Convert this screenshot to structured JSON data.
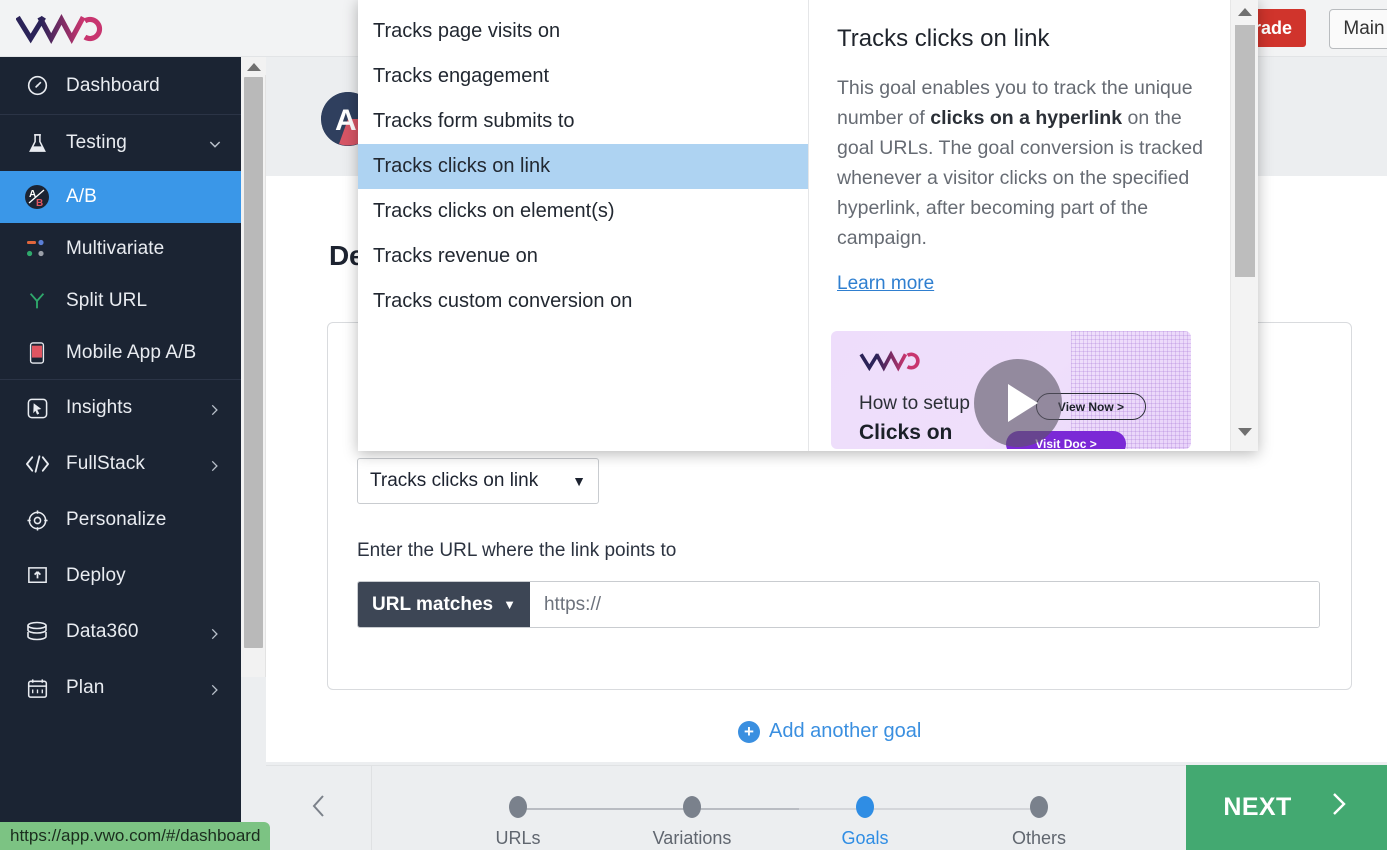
{
  "topbar": {
    "logo_alt": "VWO",
    "upgrade_label": "rade",
    "main_label": "Main"
  },
  "sidebar": {
    "items": [
      {
        "icon": "dashboard-icon",
        "label": "Dashboard",
        "chevron": "",
        "active": false
      },
      {
        "icon": "flask-icon",
        "label": "Testing",
        "chevron": "⌄",
        "active": false
      },
      {
        "icon": "ab-icon",
        "label": "A/B",
        "chevron": "",
        "active": true
      },
      {
        "icon": "multivariate-icon",
        "label": "Multivariate",
        "chevron": "",
        "active": false
      },
      {
        "icon": "split-url-icon",
        "label": "Split URL",
        "chevron": "",
        "active": false
      },
      {
        "icon": "mobile-icon",
        "label": "Mobile App A/B",
        "chevron": "",
        "active": false
      },
      {
        "icon": "insights-icon",
        "label": "Insights",
        "chevron": "›",
        "active": false
      },
      {
        "icon": "code-icon",
        "label": "FullStack",
        "chevron": "›",
        "active": false
      },
      {
        "icon": "target-icon",
        "label": "Personalize",
        "chevron": "",
        "active": false
      },
      {
        "icon": "deploy-icon",
        "label": "Deploy",
        "chevron": "",
        "active": false
      },
      {
        "icon": "database-icon",
        "label": "Data360",
        "chevron": "›",
        "active": false
      },
      {
        "icon": "calendar-icon",
        "label": "Plan",
        "chevron": "›",
        "active": false
      }
    ]
  },
  "main": {
    "page_title": "De",
    "goal_type_value": "Tracks clicks on link",
    "url_label": "Enter the URL where the link points to",
    "url_match_value": "URL matches",
    "url_input_value": "https://",
    "url_input_placeholder": "https://",
    "add_goal_label": "Add another goal",
    "add_goal_plus": "+"
  },
  "dropdown": {
    "options": [
      "Tracks page visits on",
      "Tracks engagement",
      "Tracks form submits to",
      "Tracks clicks on link",
      "Tracks clicks on element(s)",
      "Tracks revenue on",
      "Tracks custom conversion on"
    ],
    "selected": "Tracks clicks on link",
    "info": {
      "title": "Tracks clicks on link",
      "body_part1": "This goal enables you to track the unique number of ",
      "body_bold1": "clicks on a hyperlink",
      "body_part2": " on the goal URLs. The goal conversion is tracked whenever a visitor clicks on the specified hyperlink, after becoming part of the campaign.",
      "learn_more": "Learn more"
    },
    "video": {
      "logo_alt": "VWO",
      "line1": "How to setup",
      "line2": "Clicks on",
      "view_now": "View Now >",
      "visit_btn": "Visit Doc >"
    }
  },
  "footer": {
    "back_icon": "chevron-left-icon",
    "steps": [
      {
        "label": "URLs",
        "current": false
      },
      {
        "label": "Variations",
        "current": false
      },
      {
        "label": "Goals",
        "current": true
      },
      {
        "label": "Others",
        "current": false
      }
    ],
    "next_label": "NEXT",
    "next_icon": "chevron-right-icon"
  },
  "status_bar": {
    "url": "https://app.vwo.com/#/dashboard"
  },
  "colors": {
    "accent_blue": "#3a97e8",
    "sidebar_bg": "#1b2433",
    "next_green": "#43a971",
    "upgrade_red": "#d0342c",
    "highlight_blue": "#aed3f2",
    "status_green": "#7cc383"
  }
}
